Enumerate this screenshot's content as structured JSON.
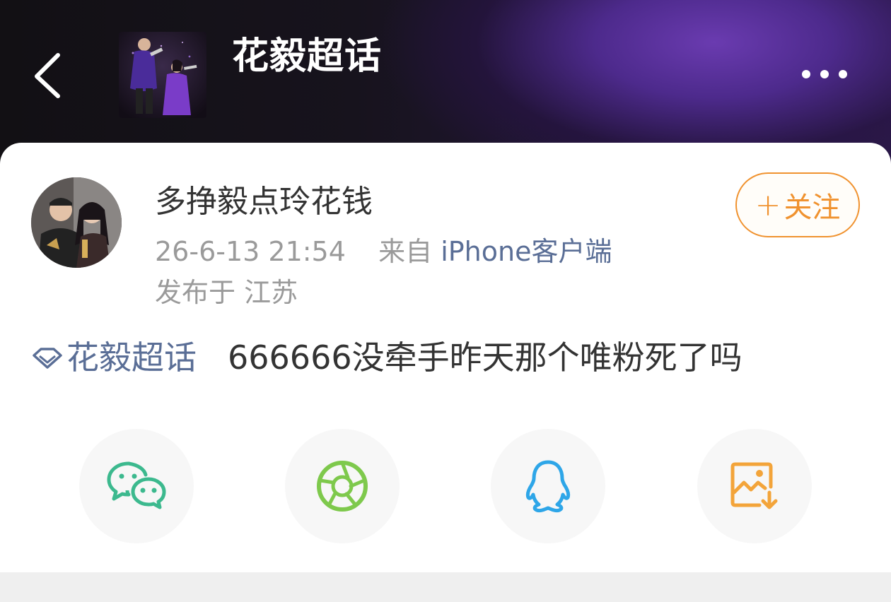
{
  "header": {
    "title": "花毅超话",
    "back_icon": "chevron-left-icon",
    "more_icon": "more-horizontal-icon"
  },
  "post": {
    "author": "多挣毅点玲花钱",
    "date": "26-6-13 21:54",
    "source_prefix": "来自",
    "source_client": "iPhone客户端",
    "location": "发布于 江苏",
    "follow_label": "关注",
    "follow_plus": "+",
    "topic_tag": "花毅超话",
    "content": "666666没牵手昨天那个唯粉死了吗"
  },
  "share": [
    {
      "name": "wechat",
      "icon": "wechat-icon",
      "color": "#3cb98e"
    },
    {
      "name": "moments",
      "icon": "aperture-icon",
      "color": "#7ec94c"
    },
    {
      "name": "qq",
      "icon": "qq-penguin-icon",
      "color": "#2ea6e8"
    },
    {
      "name": "save-image",
      "icon": "image-download-icon",
      "color": "#f3a43a"
    }
  ],
  "colors": {
    "accent_orange": "#f0922f",
    "link_blue": "#5a6e96",
    "header_purple": "#5a2fa0"
  }
}
